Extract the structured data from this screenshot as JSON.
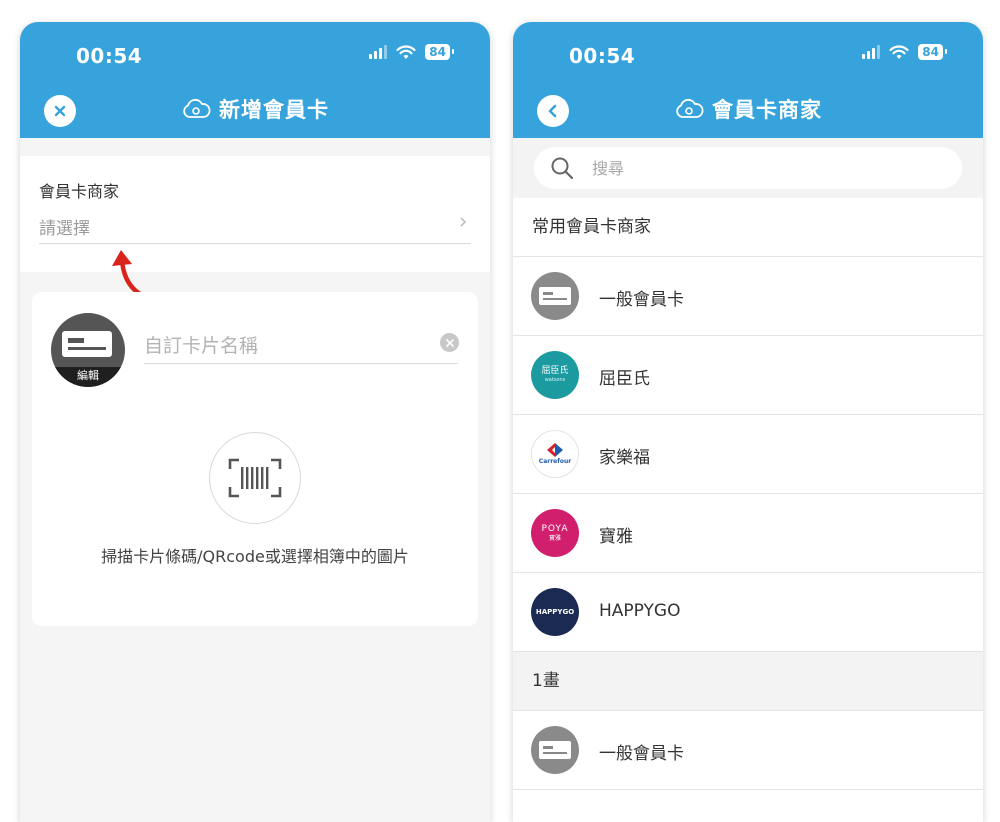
{
  "left_screen": {
    "status": {
      "time": "00:54",
      "battery": "84"
    },
    "nav": {
      "title": "新增會員卡",
      "close_icon": "close-icon"
    },
    "merchant_field": {
      "label": "會員卡商家",
      "placeholder": "請選擇"
    },
    "card": {
      "edit_label": "編輯",
      "name_placeholder": "自訂卡片名稱",
      "scan_instruction": "掃描卡片條碼/QRcode或選擇相簿中的圖片"
    }
  },
  "right_screen": {
    "status": {
      "time": "00:54",
      "battery": "84"
    },
    "nav": {
      "title": "會員卡商家",
      "back_icon": "chevron-left-icon"
    },
    "search": {
      "placeholder": "搜尋"
    },
    "sections": [
      {
        "header": "常用會員卡商家",
        "items": [
          {
            "label": "一般會員卡",
            "logo": "card-icon",
            "logo_bg": "#8a8a8a"
          },
          {
            "label": "屈臣氏",
            "logo": "watsons-logo",
            "logo_text": "屈臣氏",
            "logo_subtext": "watsons",
            "logo_bg": "#1b9aa0"
          },
          {
            "label": "家樂福",
            "logo": "carrefour-logo",
            "logo_text": "Carrefour",
            "logo_bg": "#ffffff"
          },
          {
            "label": "寶雅",
            "logo": "poya-logo",
            "logo_text": "POYA",
            "logo_subtext": "寶雅",
            "logo_bg": "#d11f6e"
          },
          {
            "label": "HAPPYGO",
            "logo": "happygo-logo",
            "logo_text": "HAPPYGO",
            "logo_bg": "#1a2a52"
          }
        ]
      },
      {
        "header": "1畫",
        "items": [
          {
            "label": "一般會員卡",
            "logo": "card-icon",
            "logo_bg": "#8a8a8a"
          }
        ]
      }
    ]
  },
  "colors": {
    "primary": "#37a3dc",
    "arrow": "#d9241c",
    "background": "#f5f5f5"
  }
}
